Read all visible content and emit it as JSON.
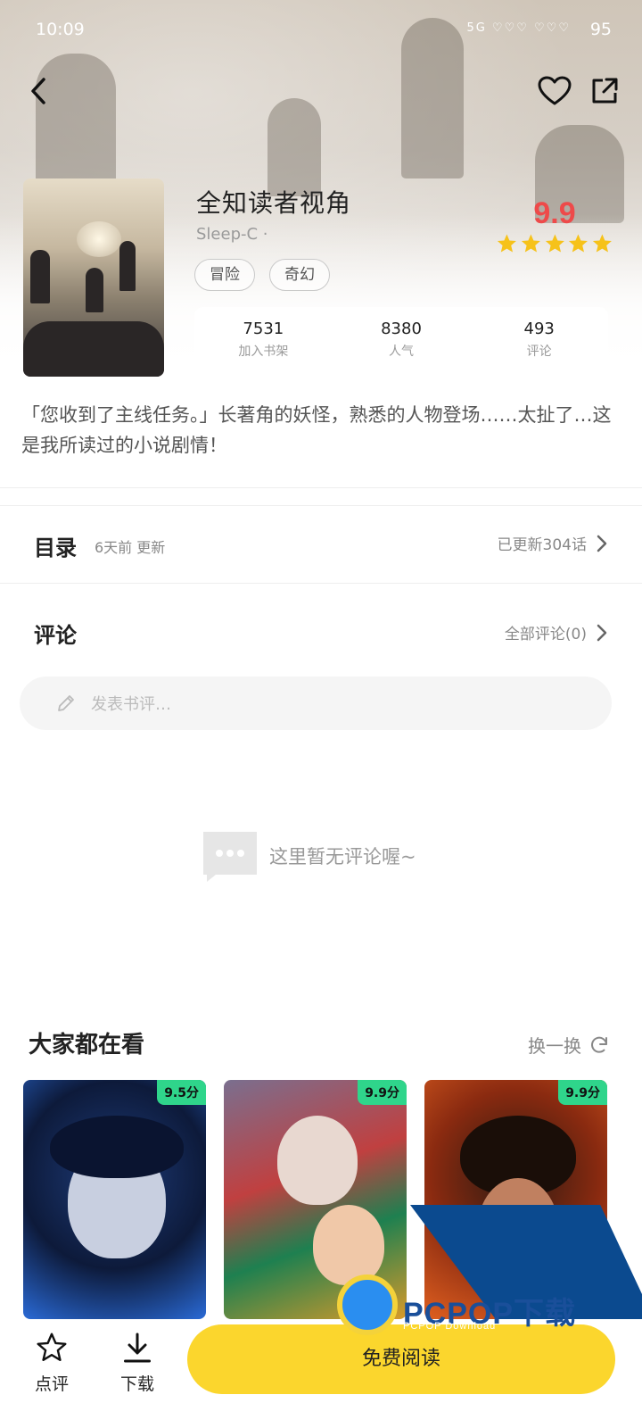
{
  "status_bar": {
    "time": "10:09",
    "battery": "95",
    "network": "5G"
  },
  "book": {
    "title": "全知读者视角",
    "author": "Sleep-C ·",
    "tags": [
      "冒险",
      "奇幻"
    ],
    "rating": "9.9",
    "stars": 5,
    "stats": [
      {
        "value": "7531",
        "label": "加入书架"
      },
      {
        "value": "8380",
        "label": "人气"
      },
      {
        "value": "493",
        "label": "评论"
      }
    ],
    "description": "「您收到了主线任务。」长著角的妖怪，熟悉的人物登场……太扯了…这是我所读过的小说剧情！"
  },
  "catalog": {
    "title": "目录",
    "updated": "6天前 更新",
    "count_text": "已更新304话"
  },
  "comments": {
    "title": "评论",
    "all_link": "全部评论(0)",
    "input_placeholder": "发表书评…",
    "empty_text": "这里暂无评论喔~"
  },
  "recommend": {
    "title": "大家都在看",
    "refresh": "换一换",
    "items": [
      {
        "score": "9.5分"
      },
      {
        "score": "9.9分"
      },
      {
        "score": "9.9分"
      }
    ]
  },
  "bottom_bar": {
    "review": "点评",
    "download": "下载",
    "read": "免费阅读"
  },
  "watermark": {
    "text": "PCPOP下载",
    "sub": "PCPOP Download"
  },
  "colors": {
    "accent_yellow": "#fbd62d",
    "rating_red": "#ee4a4a",
    "star": "#f6c21a",
    "badge_green": "#2fd58b"
  }
}
